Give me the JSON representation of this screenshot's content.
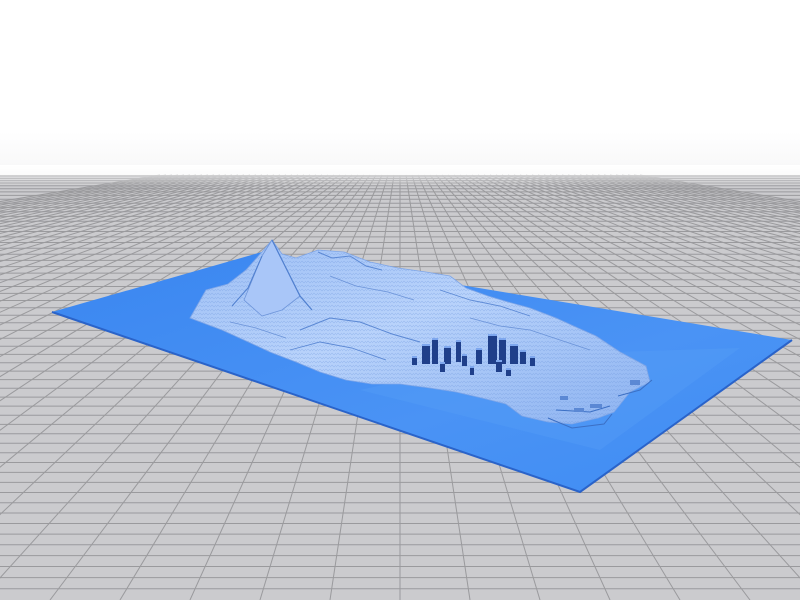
{
  "viewport": {
    "background_color": "#ffffff",
    "floor_color": "#c9c9cc",
    "grid_color": "#9a9a9d"
  },
  "model": {
    "base_color": "#3f8cf3",
    "base_edge_color": "#2a63c9",
    "terrain_light_color": "#b9d3fb",
    "terrain_dark_color": "#5a8ad6",
    "building_color": "#1f3f8a"
  }
}
